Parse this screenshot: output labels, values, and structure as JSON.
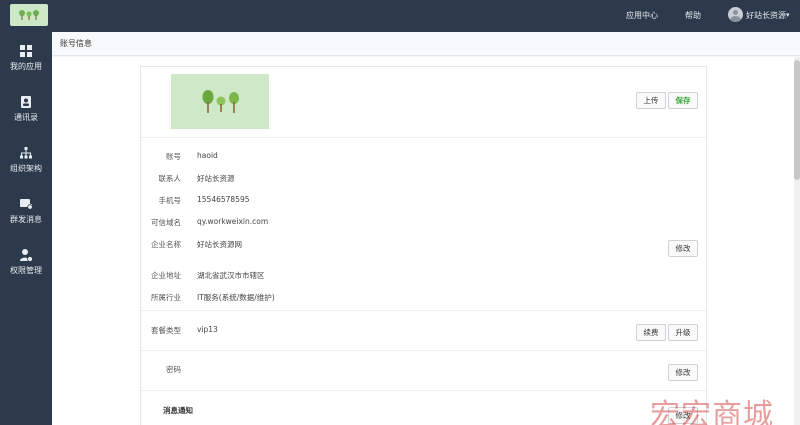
{
  "header": {
    "links": [
      {
        "label": "应用中心"
      },
      {
        "label": "帮助"
      }
    ],
    "user_name": "好站长资源",
    "caret": "▾"
  },
  "sidebar": {
    "items": [
      {
        "label": "我的应用",
        "icon": "grid-icon"
      },
      {
        "label": "通讯录",
        "icon": "contact-book-icon"
      },
      {
        "label": "组织架构",
        "icon": "org-chart-icon"
      },
      {
        "label": "群发消息",
        "icon": "message-icon"
      },
      {
        "label": "权限管理",
        "icon": "user-settings-icon"
      }
    ]
  },
  "breadcrumb": "账号信息",
  "logo_section": {
    "upload_label": "上传",
    "save_label": "保存"
  },
  "account": {
    "fields": [
      {
        "label": "账号",
        "value": "haoid"
      },
      {
        "label": "联系人",
        "value": "好站长资源"
      },
      {
        "label": "手机号",
        "value": "15546578595"
      },
      {
        "label": "可信域名",
        "value": "qy.workweixin.com"
      },
      {
        "label": "企业名称",
        "value": "好站长资源网"
      },
      {
        "label": "企业地址",
        "value": "湖北省武汉市市辖区"
      },
      {
        "label": "所属行业",
        "value": "IT服务(系统/数据/维护)"
      }
    ],
    "edit_label": "修改"
  },
  "plan": {
    "label": "套餐类型",
    "value": "vip13",
    "renew_label": "续费",
    "upgrade_label": "升级"
  },
  "password": {
    "label": "密码",
    "edit_label": "修改"
  },
  "notification": {
    "title": "消息通知",
    "edit_label": "修改"
  },
  "watermark": "宏宏商城",
  "colors": {
    "topbar": "#2c3a4c",
    "sidebar": "#2c3a4c",
    "logo_bg": "#cfe8c8",
    "save_green": "#3aa23a"
  }
}
